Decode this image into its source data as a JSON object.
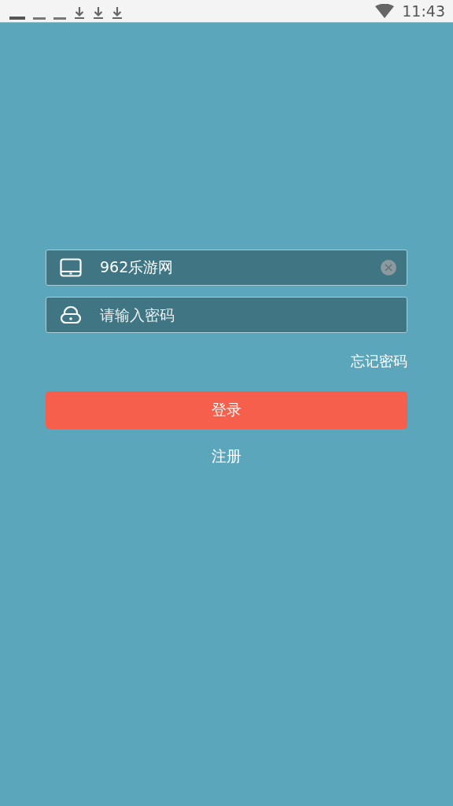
{
  "status_bar": {
    "time": "11:43"
  },
  "login": {
    "username": {
      "value": "962乐游网"
    },
    "password": {
      "placeholder": "请输入密码"
    },
    "forgot_link": "忘记密码",
    "login_button": "登录",
    "register_link": "注册"
  }
}
